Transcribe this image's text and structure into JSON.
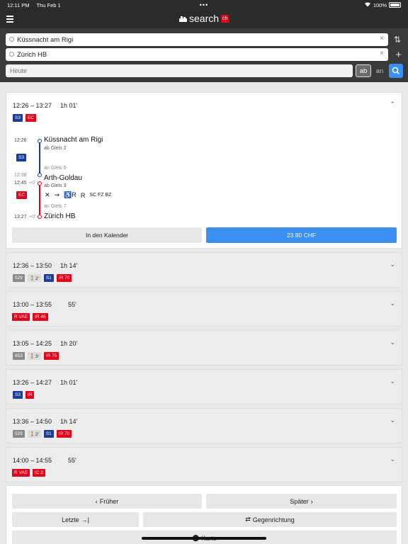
{
  "status": {
    "time": "12:11 PM",
    "date": "Thu Feb 1",
    "battery": "100%"
  },
  "header": {
    "logo_text": "search",
    "logo_suffix": "ch"
  },
  "search": {
    "from": "Küssnacht am Rigi",
    "to": "Zürich HB",
    "date_placeholder": "Heute",
    "mode_ab": "ab",
    "mode_an": "an",
    "clear_glyph": "×",
    "swap_glyph": "⇅",
    "add_glyph": "+"
  },
  "connections": [
    {
      "time": "12:26 – 13:27",
      "duration": "1h 01'",
      "badges": [
        {
          "text": "S3",
          "color": "blue"
        },
        {
          "text": "EC",
          "color": "red"
        }
      ],
      "expanded": true,
      "detail": {
        "stops": [
          {
            "time": "12:26",
            "name": "Küssnacht am Rigi",
            "platform": "ab Gleis 2"
          },
          {
            "time_arr": "12:38",
            "time_dep": "12:45",
            "delay": "+0'",
            "name": "Arth-Goldau",
            "arr_platform": "an Gleis 5",
            "dep_platform": "ab Gleis 3"
          },
          {
            "time": "13:27",
            "delay": "+0'",
            "name": "Zürich HB",
            "platform": "an Gleis 7"
          }
        ],
        "leg_badges": [
          {
            "text": "S3",
            "color": "blue"
          },
          {
            "text": "EC",
            "color": "red"
          }
        ],
        "facilities": [
          "✕",
          "⇝",
          "♿R",
          "R"
        ],
        "facilities_small": "SC FZ BZ",
        "calendar_label": "In den Kalender",
        "price_label": "23.80 CHF"
      }
    },
    {
      "time": "12:36 – 13:50",
      "duration": "1h 14'",
      "badges": [
        {
          "text": "529",
          "color": "gray"
        },
        {
          "text": "🚶2'",
          "color": "walk"
        },
        {
          "text": "S1",
          "color": "blue"
        },
        {
          "text": "IR 70",
          "color": "red"
        }
      ]
    },
    {
      "time": "13:00 – 13:55",
      "duration": "55'",
      "badges": [
        {
          "text": "R VAE",
          "color": "red"
        },
        {
          "text": "IR 46",
          "color": "red"
        }
      ]
    },
    {
      "time": "13:05 – 14:25",
      "duration": "1h 20'",
      "badges": [
        {
          "text": "653",
          "color": "gray"
        },
        {
          "text": "🚶3'",
          "color": "walk"
        },
        {
          "text": "IR 75",
          "color": "red"
        }
      ]
    },
    {
      "time": "13:26 – 14:27",
      "duration": "1h 01'",
      "badges": [
        {
          "text": "S3",
          "color": "blue"
        },
        {
          "text": "IR",
          "color": "red"
        }
      ]
    },
    {
      "time": "13:36 – 14:50",
      "duration": "1h 14'",
      "badges": [
        {
          "text": "529",
          "color": "gray"
        },
        {
          "text": "🚶2'",
          "color": "walk"
        },
        {
          "text": "S1",
          "color": "blue"
        },
        {
          "text": "IR 70",
          "color": "red"
        }
      ]
    },
    {
      "time": "14:00 – 14:55",
      "duration": "55'",
      "badges": [
        {
          "text": "R VAE",
          "color": "red"
        },
        {
          "text": "IC 2",
          "color": "red"
        }
      ]
    }
  ],
  "nav": {
    "earlier": "Früher",
    "later": "Später",
    "last": "Letzte",
    "reverse": "Gegenrichtung",
    "map": "Karte"
  },
  "colors": {
    "blue": "#1b3d99",
    "red": "#e2001a",
    "accent": "#3a8ff0"
  }
}
